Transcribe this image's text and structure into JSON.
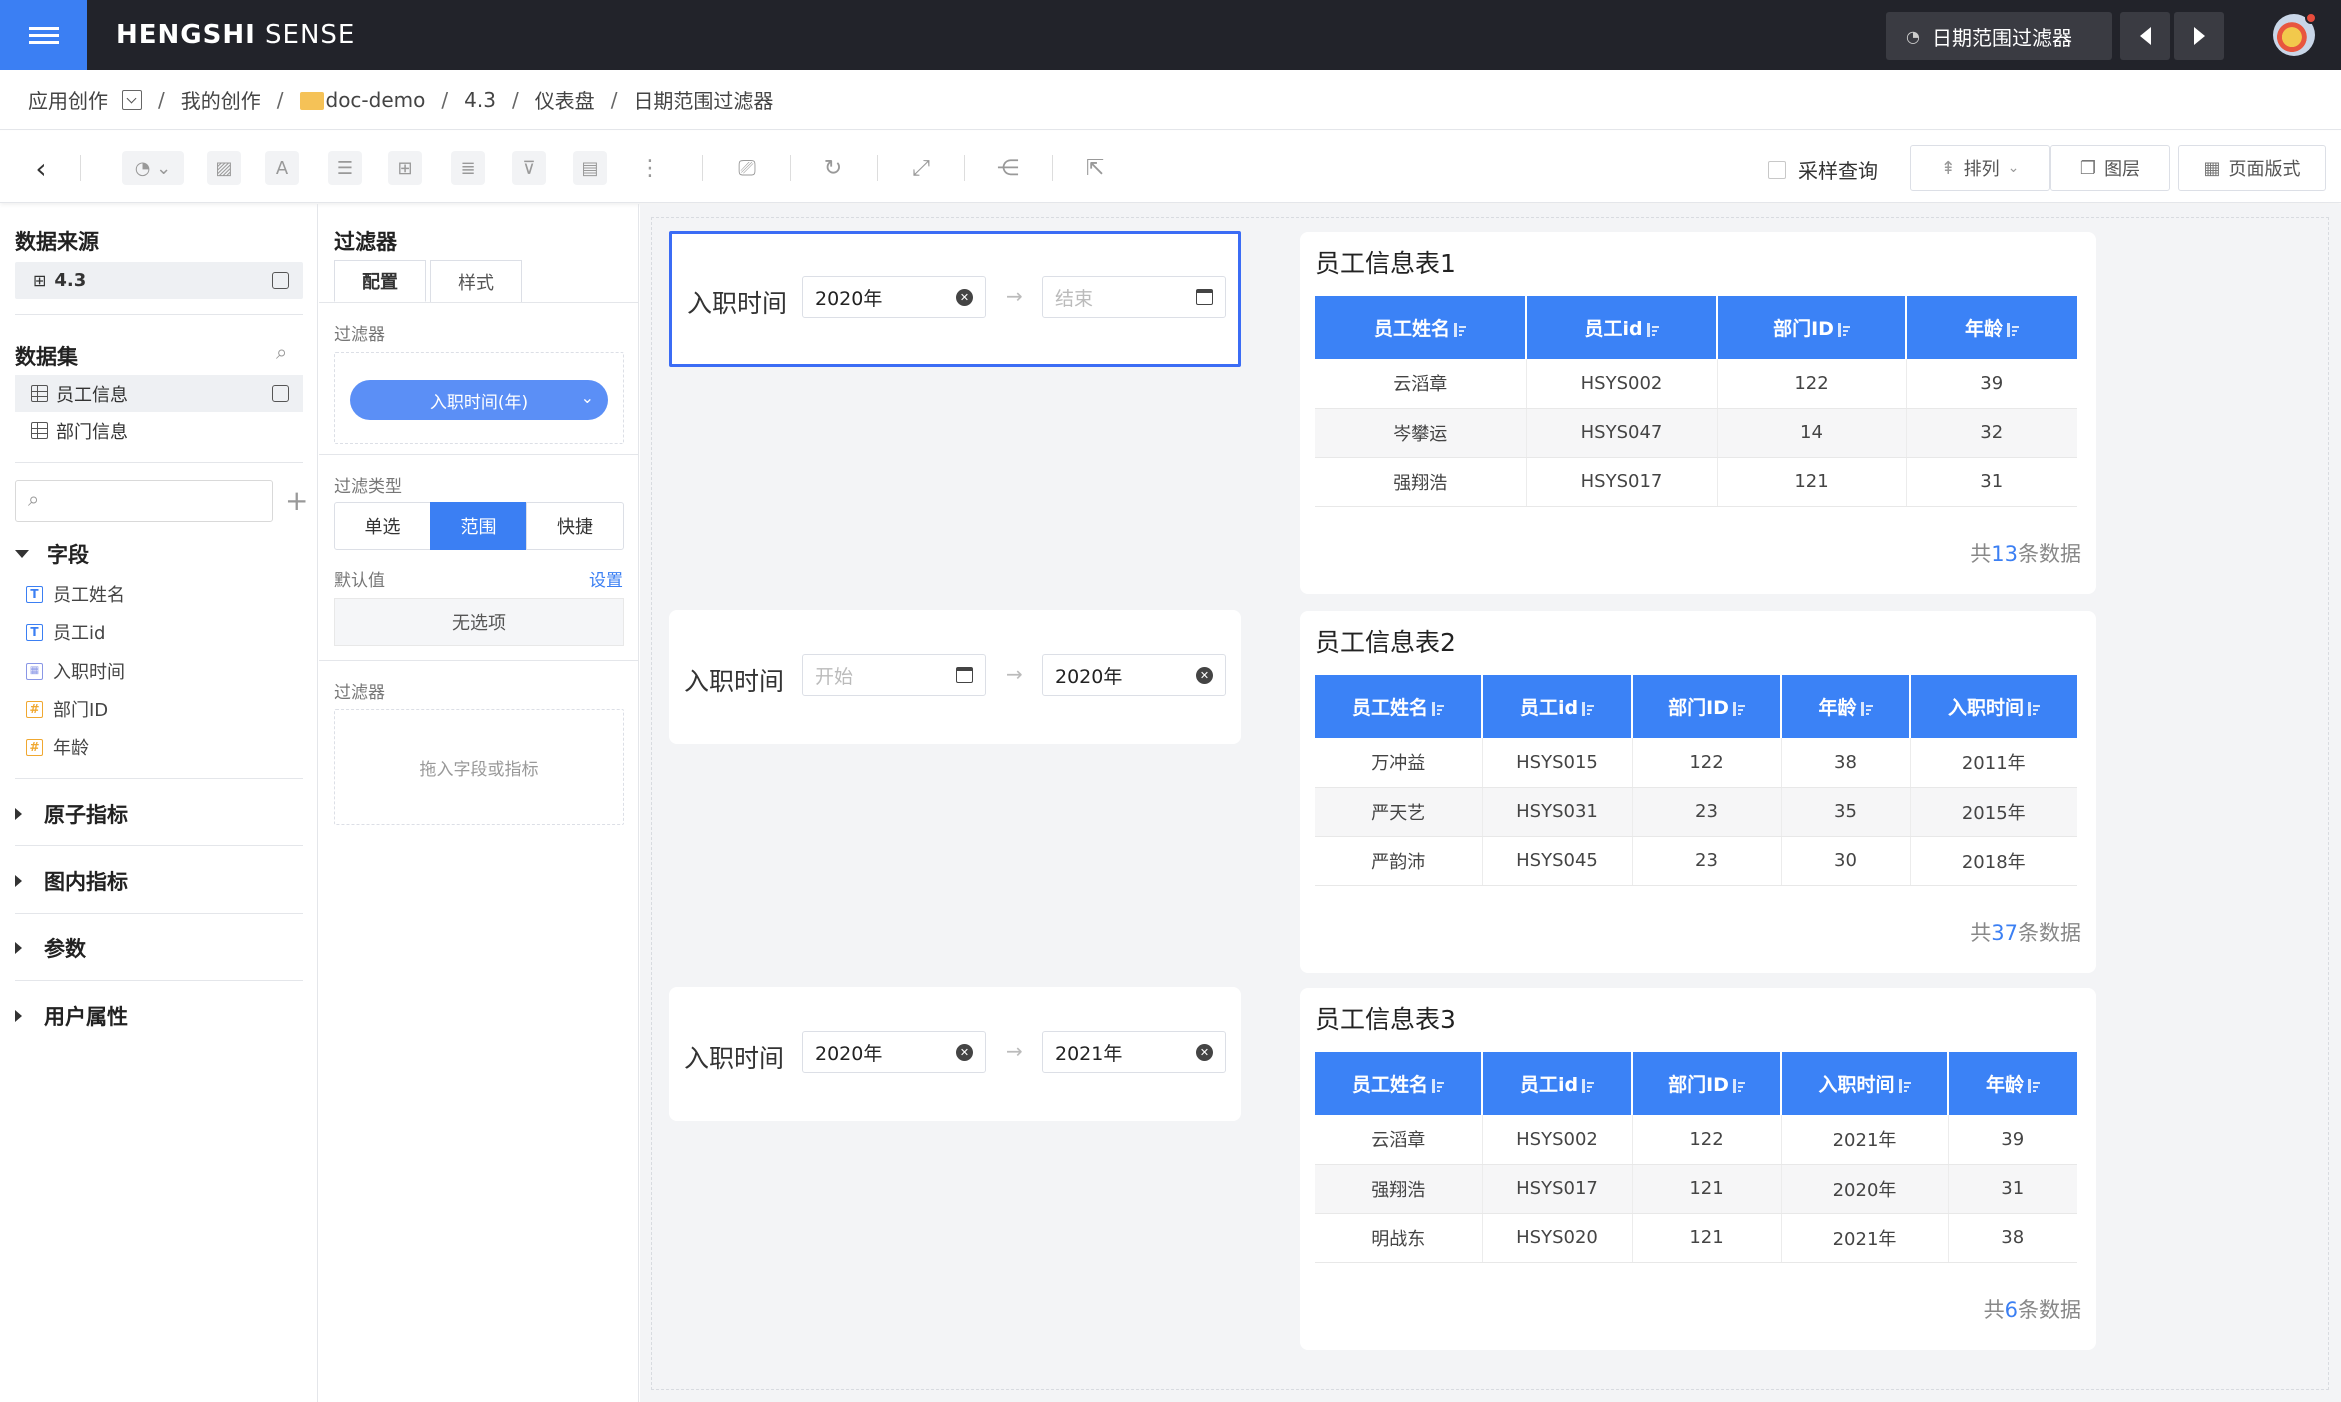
{
  "topbar": {
    "brand_bold": "HENGSHI",
    "brand_thin": " SENSE",
    "page_filter_label": "日期范围过滤器",
    "accent_color": "#3b7ff3"
  },
  "breadcrumb": {
    "items": [
      "应用创作",
      "我的创作",
      "doc-demo",
      "4.3",
      "仪表盘",
      "日期范围过滤器"
    ]
  },
  "toolbar": {
    "sample_query_label": "采样查询",
    "sort_label": "排列",
    "layers_label": "图层",
    "page_style_label": "页面版式"
  },
  "left": {
    "datasource_title": "数据来源",
    "datasource_item": "4.3",
    "dataset_title": "数据集",
    "datasets": [
      "员工信息",
      "部门信息"
    ],
    "fields_title": "字段",
    "fields": [
      {
        "name": "员工姓名",
        "type": "T"
      },
      {
        "name": "员工id",
        "type": "T"
      },
      {
        "name": "入职时间",
        "type": "date"
      },
      {
        "name": "部门ID",
        "type": "#"
      },
      {
        "name": "年龄",
        "type": "#"
      }
    ],
    "groups": [
      "原子指标",
      "图内指标",
      "参数",
      "用户属性"
    ]
  },
  "filter_panel": {
    "title": "过滤器",
    "tabs": [
      "配置",
      "样式"
    ],
    "filter_label": "过滤器",
    "filter_pill": "入职时间(年)",
    "type_label": "过滤类型",
    "types": [
      "单选",
      "范围",
      "快捷"
    ],
    "default_label": "默认值",
    "set_link": "设置",
    "no_option": "无选项",
    "filter2_label": "过滤器",
    "drop_hint": "拖入字段或指标"
  },
  "filters": [
    {
      "label": "入职时间",
      "start": "2020年",
      "start_placeholder": "",
      "end": "",
      "end_placeholder": "结束"
    },
    {
      "label": "入职时间",
      "start": "",
      "start_placeholder": "开始",
      "end": "2020年",
      "end_placeholder": ""
    },
    {
      "label": "入职时间",
      "start": "2020年",
      "start_placeholder": "",
      "end": "2021年",
      "end_placeholder": ""
    }
  ],
  "tables": [
    {
      "title": "员工信息表1",
      "columns": [
        "员工姓名",
        "员工id",
        "部门ID",
        "年龄"
      ],
      "rows": [
        [
          "云滔章",
          "HSYS002",
          "122",
          "39"
        ],
        [
          "岑攀运",
          "HSYS047",
          "14",
          "32"
        ],
        [
          "强翔浩",
          "HSYS017",
          "121",
          "31"
        ]
      ],
      "total_prefix": "共",
      "total_count": "13",
      "total_suffix": "条数据"
    },
    {
      "title": "员工信息表2",
      "columns": [
        "员工姓名",
        "员工id",
        "部门ID",
        "年龄",
        "入职时间"
      ],
      "rows": [
        [
          "万冲益",
          "HSYS015",
          "122",
          "38",
          "2011年"
        ],
        [
          "严天艺",
          "HSYS031",
          "23",
          "35",
          "2015年"
        ],
        [
          "严韵沛",
          "HSYS045",
          "23",
          "30",
          "2018年"
        ]
      ],
      "total_prefix": "共",
      "total_count": "37",
      "total_suffix": "条数据"
    },
    {
      "title": "员工信息表3",
      "columns": [
        "员工姓名",
        "员工id",
        "部门ID",
        "入职时间",
        "年龄"
      ],
      "rows": [
        [
          "云滔章",
          "HSYS002",
          "122",
          "2021年",
          "39"
        ],
        [
          "强翔浩",
          "HSYS017",
          "121",
          "2020年",
          "31"
        ],
        [
          "明战东",
          "HSYS020",
          "121",
          "2021年",
          "38"
        ]
      ],
      "total_prefix": "共",
      "total_count": "6",
      "total_suffix": "条数据"
    }
  ]
}
